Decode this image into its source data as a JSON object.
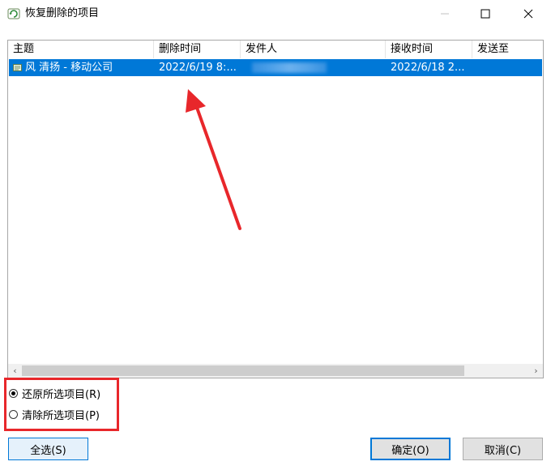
{
  "window": {
    "title": "恢复删除的项目",
    "icon": "recover-icon"
  },
  "columns": [
    {
      "label": "主题"
    },
    {
      "label": "删除时间"
    },
    {
      "label": "发件人"
    },
    {
      "label": "接收时间"
    },
    {
      "label": "发送至"
    }
  ],
  "rows": [
    {
      "subject": "风 清扬 - 移动公司",
      "deleted_time": "2022/6/19 8:...",
      "sender": "",
      "received_time": "2022/6/18 2...",
      "sent_to": "",
      "selected": true
    }
  ],
  "options": {
    "restore_label": "还原所选项目(R)",
    "purge_label": "清除所选项目(P)",
    "selected": "restore"
  },
  "buttons": {
    "select_all": "全选(S)",
    "ok": "确定(O)",
    "cancel": "取消(C)"
  },
  "colors": {
    "selection": "#0078d7",
    "annotation": "#e8272b"
  }
}
